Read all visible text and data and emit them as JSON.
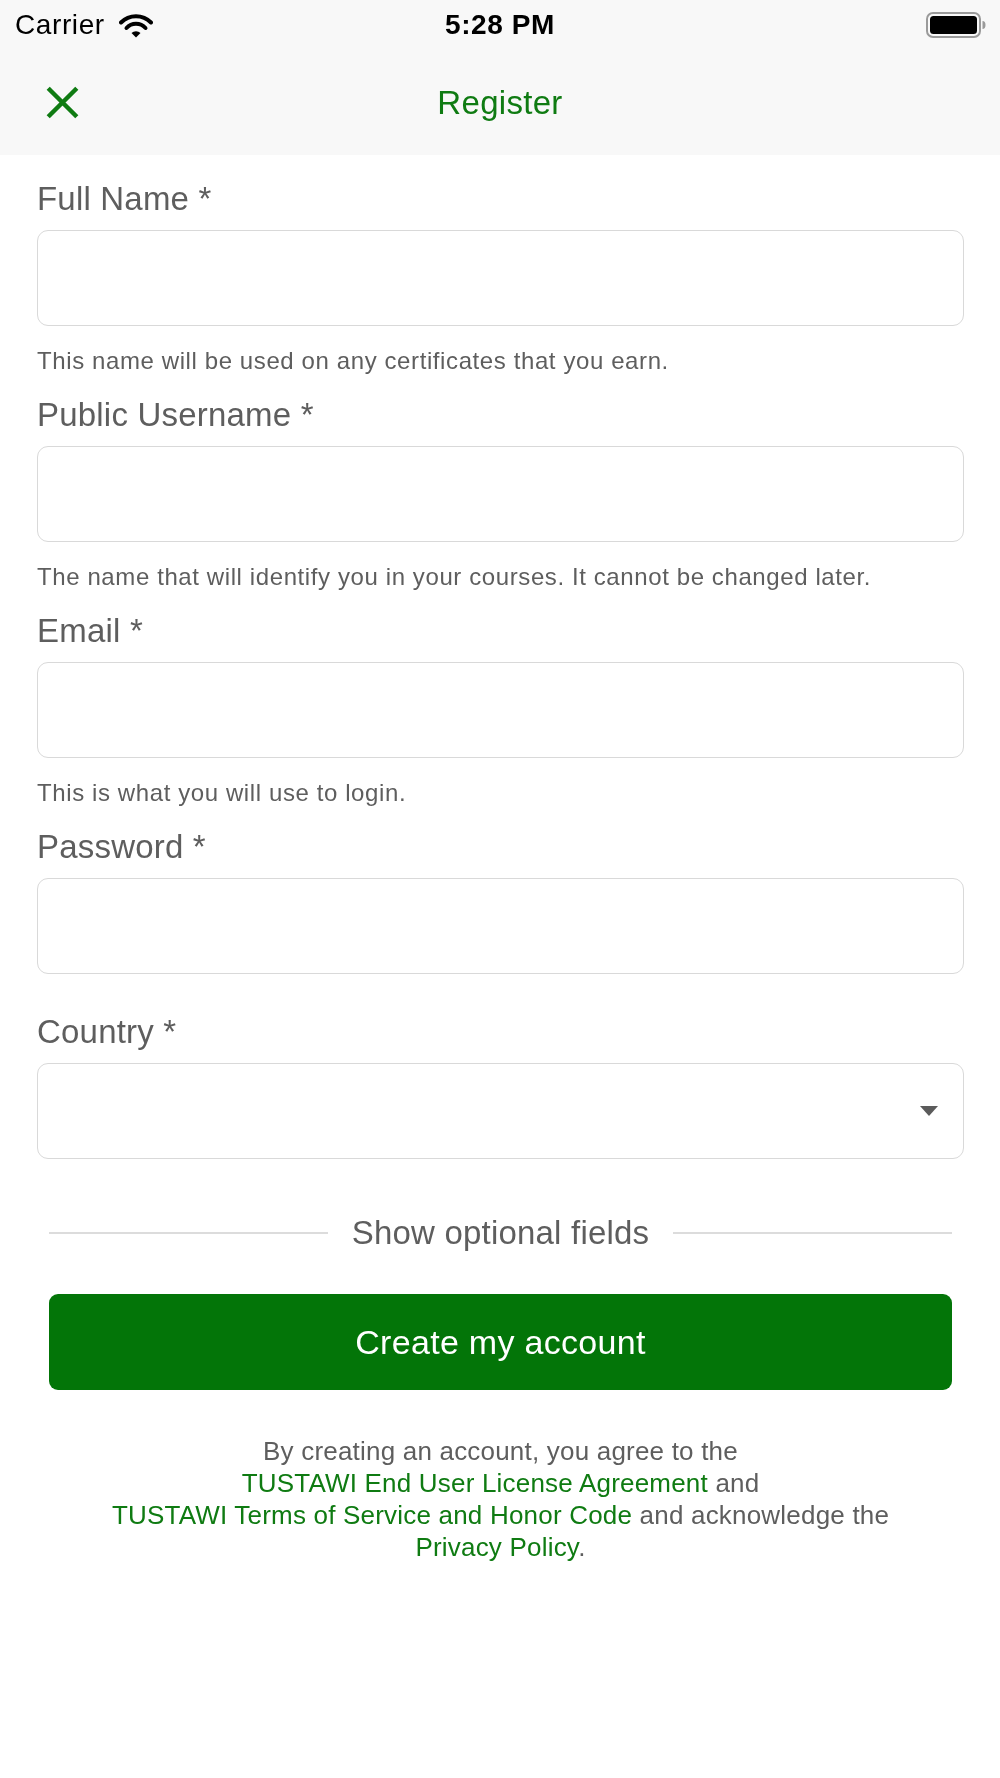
{
  "status_bar": {
    "carrier": "Carrier",
    "time": "5:28 PM"
  },
  "nav_bar": {
    "title": "Register"
  },
  "fields": [
    {
      "kind": "input",
      "label": "Full Name *",
      "hint": "This name will be used on any certificates that you earn."
    },
    {
      "kind": "input",
      "label": "Public Username *",
      "hint": "The name that will identify you in your courses. It cannot be changed later."
    },
    {
      "kind": "input",
      "label": "Email *",
      "hint": "This is what you will use to login."
    },
    {
      "kind": "input",
      "label": "Password *"
    },
    {
      "kind": "select",
      "label": "Country *"
    }
  ],
  "optional_toggle": {
    "label": "Show optional fields"
  },
  "submit_button": {
    "label": "Create my account"
  },
  "legal_text": [
    {
      "kind": "text",
      "text": "By creating an account, you agree to the "
    },
    {
      "kind": "link",
      "text": "TUSTAWI End User License Agreement"
    },
    {
      "kind": "text",
      "text": " and "
    },
    {
      "kind": "link",
      "text": "TUSTAWI Terms of Service and Honor Code"
    },
    {
      "kind": "text",
      "text": " and acknowledge the "
    },
    {
      "kind": "link",
      "text": "Privacy Policy"
    },
    {
      "kind": "text",
      "text": "."
    }
  ]
}
